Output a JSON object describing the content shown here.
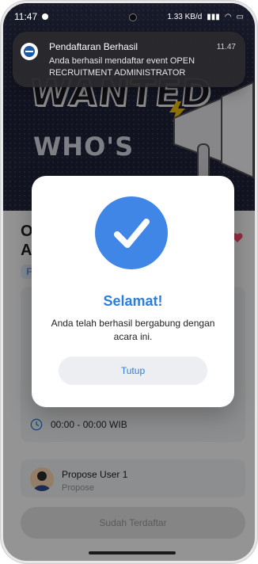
{
  "status_bar": {
    "time": "11:47",
    "net_speed": "1.33 KB/d"
  },
  "banner": {
    "word_top": "WANTED",
    "word_bottom": "WHO'S"
  },
  "event": {
    "title_fragment": "O\nAI",
    "category_fragment": "F"
  },
  "time_row": {
    "label": "00:00 - 00:00 WIB"
  },
  "user": {
    "name": "Propose User 1",
    "role": "Propose"
  },
  "bottom_button": {
    "label": "Sudah Terdaftar"
  },
  "notification": {
    "title": "Pendaftaran Berhasil",
    "time": "11.47",
    "body": "Anda berhasil mendaftar event OPEN RECRUITMENT ADMINISTRATOR"
  },
  "modal": {
    "heading": "Selamat!",
    "message": "Anda telah berhasil bergabung dengan acara ini.",
    "close_label": "Tutup"
  },
  "colors": {
    "accent": "#2a7ee0",
    "check_circle": "#3f86e6",
    "overlay": "rgba(0,0,0,0.42)"
  }
}
